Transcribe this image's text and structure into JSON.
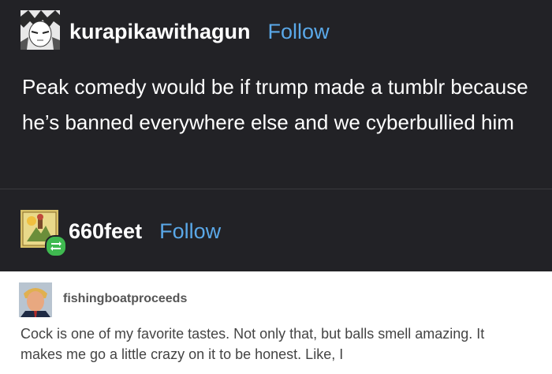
{
  "post1": {
    "username": "kurapikawithagun",
    "follow_label": "Follow",
    "body": "Peak comedy would be if trump made a tumblr because he’s banned everywhere else and we cyberbullied him",
    "avatar_icon": "anime-character-avatar-icon"
  },
  "post2": {
    "username": "660feet",
    "follow_label": "Follow",
    "avatar_icon": "tarot-card-avatar-icon",
    "reblog_icon": "reblog-icon"
  },
  "quoted": {
    "username": "fishingboatproceeds",
    "text": "Cock is one of my favorite tastes. Not only that, but balls smell amazing. It makes me go a little crazy on it to be honest. Like, I",
    "avatar_icon": "man-portrait-avatar-icon"
  },
  "colors": {
    "background": "#222226",
    "follow": "#5aa8e8",
    "reblog_badge": "#3fb950",
    "quoted_background": "#ffffff"
  }
}
